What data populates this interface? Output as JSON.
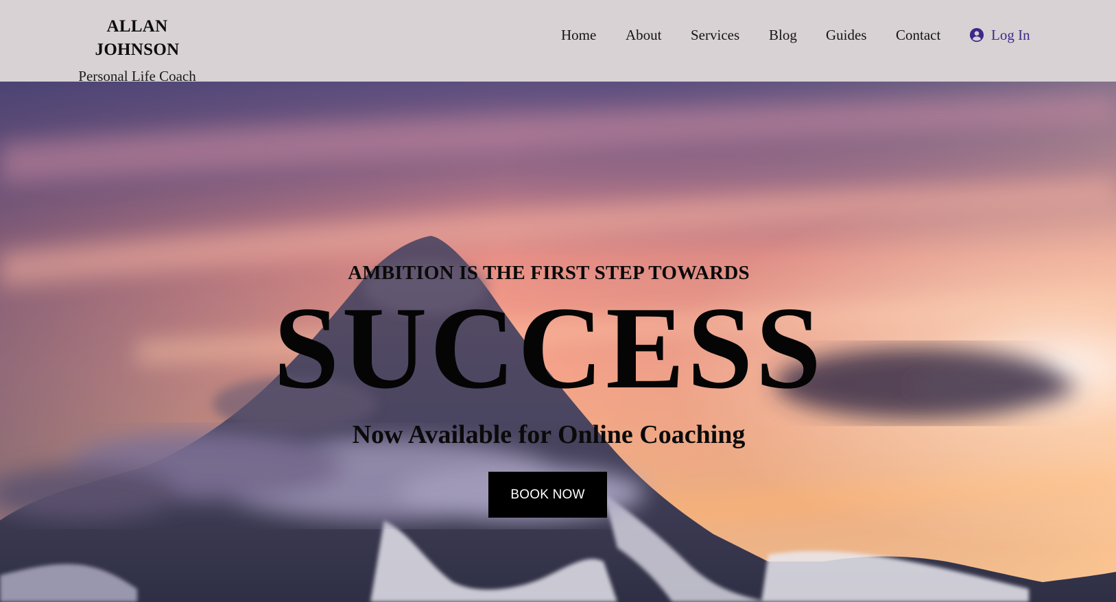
{
  "brand": {
    "name": "ALLAN JOHNSON",
    "tagline": "Personal Life Coach"
  },
  "nav": {
    "items": [
      {
        "label": "Home"
      },
      {
        "label": "About"
      },
      {
        "label": "Services"
      },
      {
        "label": "Blog"
      },
      {
        "label": "Guides"
      },
      {
        "label": "Contact"
      }
    ],
    "login": {
      "label": "Log In",
      "icon": "user-circle-icon"
    }
  },
  "hero": {
    "tagline": "AMBITION IS THE FIRST STEP TOWARDS",
    "headline": "SUCCESS",
    "subline": "Now Available for Online Coaching",
    "cta_label": "BOOK NOW",
    "background": "mountain-peak-sunset-image"
  },
  "colors": {
    "header_bg": "#d8d2d4",
    "login_accent": "#3b2a8a",
    "cta_bg": "#000000",
    "cta_text": "#ffffff"
  }
}
